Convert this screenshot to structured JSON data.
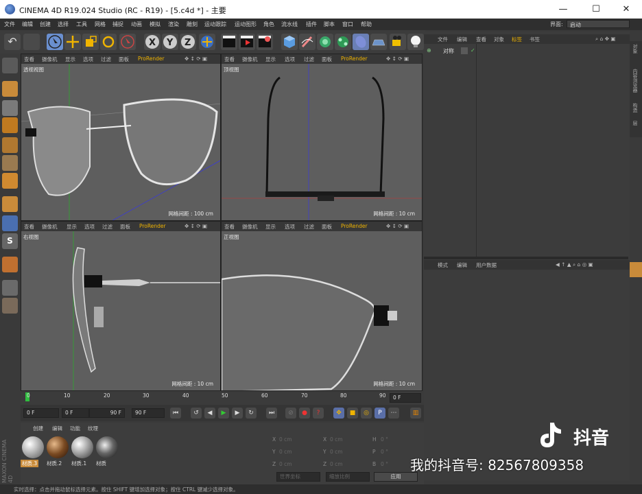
{
  "window": {
    "title": "CINEMA 4D R19.024 Studio (RC - R19) - [5.c4d *] - 主要",
    "min": "—",
    "max": "☐",
    "close": "✕"
  },
  "menu": [
    "文件",
    "编辑",
    "创建",
    "选择",
    "工具",
    "网格",
    "捕捉",
    "动画",
    "模拟",
    "渲染",
    "雕刻",
    "运动跟踪",
    "运动图形",
    "角色",
    "流水线",
    "插件",
    "脚本",
    "窗口",
    "帮助"
  ],
  "layout": {
    "label": "界面:",
    "value": "启动"
  },
  "viewports": [
    {
      "title": "透视视图",
      "menus": [
        "查看",
        "摄像机",
        "显示",
        "选项",
        "过滤",
        "面板",
        "ProRender"
      ],
      "grid": "网格间距 : 100 cm"
    },
    {
      "title": "顶视图",
      "menus": [
        "查看",
        "摄像机",
        "显示",
        "选项",
        "过滤",
        "面板",
        "ProRender"
      ],
      "grid": "网格间距 : 10 cm"
    },
    {
      "title": "右视图",
      "menus": [
        "查看",
        "摄像机",
        "显示",
        "选项",
        "过滤",
        "面板",
        "ProRender"
      ],
      "grid": "网格间距 : 10 cm"
    },
    {
      "title": "正视图",
      "menus": [
        "查看",
        "摄像机",
        "显示",
        "选项",
        "过滤",
        "面板",
        "ProRender"
      ],
      "grid": "网格间距 : 10 cm"
    }
  ],
  "object_manager": {
    "menus": [
      "文件",
      "编辑",
      "查看",
      "对象",
      "标签",
      "书签"
    ],
    "object": "对称"
  },
  "attribute_manager": {
    "menus": [
      "模式",
      "编辑",
      "用户数据"
    ]
  },
  "side_tabs": [
    "对象",
    "内容浏览器",
    "构造",
    "层"
  ],
  "timeline": {
    "ticks": [
      "0",
      "10",
      "20",
      "30",
      "40",
      "50",
      "60",
      "70",
      "80",
      "90"
    ],
    "end_frame": "0 F"
  },
  "transport": {
    "current": "0 F",
    "range_start": "0 F",
    "range_end": "90 F",
    "max": "90 F"
  },
  "materials": {
    "menus": [
      "创建",
      "编辑",
      "功能",
      "纹理"
    ],
    "items": [
      "材质.3",
      "材质.2",
      "材质.1",
      "材质"
    ]
  },
  "coords": {
    "rows": [
      {
        "a": "X",
        "av": "0 cm",
        "b": "X",
        "bv": "0 cm",
        "c": "H",
        "cv": "0 °"
      },
      {
        "a": "Y",
        "av": "0 cm",
        "b": "Y",
        "bv": "0 cm",
        "c": "P",
        "cv": "0 °"
      },
      {
        "a": "Z",
        "av": "0 cm",
        "b": "Z",
        "bv": "0 cm",
        "c": "B",
        "cv": "0 °"
      }
    ],
    "world": "世界坐标",
    "scale": "缩放比例",
    "apply": "应用"
  },
  "status": "实时选择：点击并拖动鼠标选择元素。按住 SHIFT 键增加选择对象；按住 CTRL 键减少选择对象。",
  "watermark": {
    "brand": "抖音",
    "id": "我的抖音号: 82567809358"
  },
  "maxon": "MAXON CINEMA 4D"
}
